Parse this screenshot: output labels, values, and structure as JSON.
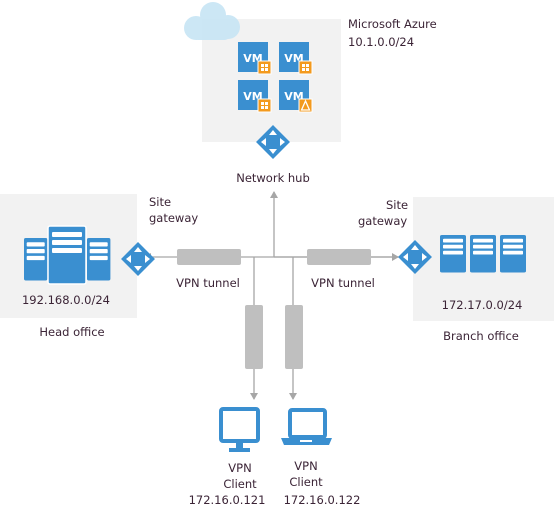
{
  "azure": {
    "title": "Microsoft Azure",
    "subnet": "10.1.0.0/24",
    "vm_label": "VM",
    "vms": [
      "windows",
      "windows",
      "windows",
      "linux"
    ]
  },
  "hub": {
    "label": "Network hub"
  },
  "head_office": {
    "gateway_line1": "Site",
    "gateway_line2": "gateway",
    "subnet": "192.168.0.0/24",
    "label": "Head office",
    "tunnel": "VPN tunnel"
  },
  "branch_office": {
    "gateway_line1": "Site",
    "gateway_line2": "gateway",
    "subnet": "172.17.0.0/24",
    "label": "Branch office",
    "tunnel": "VPN tunnel"
  },
  "clients": [
    {
      "line1": "VPN",
      "line2": "Client",
      "ip": "172.16.0.121",
      "icon": "monitor-icon"
    },
    {
      "line1": "VPN",
      "line2": "Client",
      "ip": "172.16.0.122",
      "icon": "laptop-icon"
    }
  ],
  "colors": {
    "blue": "#3a8fd0",
    "orange": "#f39a1e",
    "box": "#f2f2f2",
    "tunnel": "#bfbfbf",
    "line": "#a6a6a6",
    "cloud": "#c7e5f5"
  }
}
